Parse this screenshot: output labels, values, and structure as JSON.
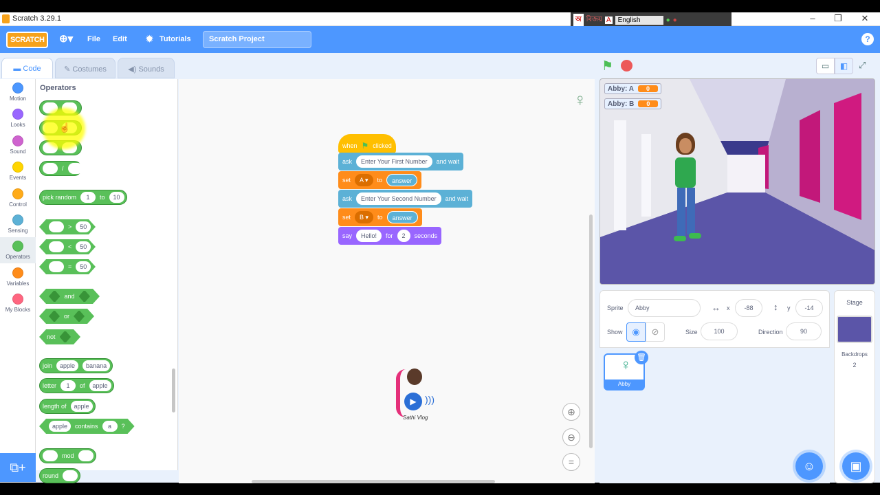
{
  "window": {
    "title": "Scratch 3.29.1"
  },
  "langbar": {
    "lang_text": "English"
  },
  "menu": {
    "logo": "SCRATCH",
    "file": "File",
    "edit": "Edit",
    "tutorials": "Tutorials",
    "project_title": "Scratch Project",
    "help": "?"
  },
  "tabs": {
    "code": "Code",
    "costumes": "Costumes",
    "sounds": "Sounds"
  },
  "categories": [
    {
      "label": "Motion",
      "color": "#4c97ff"
    },
    {
      "label": "Looks",
      "color": "#9966ff"
    },
    {
      "label": "Sound",
      "color": "#cf63cf"
    },
    {
      "label": "Events",
      "color": "#ffd500"
    },
    {
      "label": "Control",
      "color": "#ffab19"
    },
    {
      "label": "Sensing",
      "color": "#5cb1d6"
    },
    {
      "label": "Operators",
      "color": "#59c059"
    },
    {
      "label": "Variables",
      "color": "#ff8c1a"
    },
    {
      "label": "My Blocks",
      "color": "#ff6680"
    }
  ],
  "palette": {
    "heading": "Operators",
    "div_sign": "/",
    "pick_random": {
      "label": "pick random",
      "from": "1",
      "to_label": "to",
      "to": "10"
    },
    "gt": {
      "op": ">",
      "val": "50"
    },
    "lt": {
      "op": "<",
      "val": "50"
    },
    "eq": {
      "op": "=",
      "val": "50"
    },
    "and": "and",
    "or": "or",
    "not": "not",
    "join": {
      "label": "join",
      "a": "apple",
      "b": "banana"
    },
    "letter": {
      "label": "letter",
      "n": "1",
      "of": "of",
      "s": "apple"
    },
    "length": {
      "label": "length of",
      "s": "apple"
    },
    "contains": {
      "a": "apple",
      "label": "contains",
      "b": "a",
      "q": "?"
    },
    "mod": "mod",
    "round": "round"
  },
  "script": {
    "hat": {
      "when": "when",
      "clicked": "clicked"
    },
    "ask1": {
      "label": "ask",
      "text": "Enter Your First Number",
      "tail": "and wait"
    },
    "set1": {
      "label": "set",
      "var": "A ▾",
      "to": "to",
      "val": "answer"
    },
    "ask2": {
      "label": "ask",
      "text": "Enter Your Second Number",
      "tail": "and wait"
    },
    "set2": {
      "label": "set",
      "var": "B ▾",
      "to": "to",
      "val": "answer"
    },
    "say": {
      "label": "say",
      "text": "Hello!",
      "for": "for",
      "secs": "2",
      "unit": "seconds"
    }
  },
  "watermark": {
    "text": "Sathi Vlog"
  },
  "monitors": [
    {
      "label": "Abby: A",
      "value": "0"
    },
    {
      "label": "Abby: B",
      "value": "0"
    }
  ],
  "sprite_info": {
    "sprite_label": "Sprite",
    "sprite_name": "Abby",
    "x_label": "x",
    "x": "-88",
    "y_label": "y",
    "y": "-14",
    "show_label": "Show",
    "size_label": "Size",
    "size": "100",
    "direction_label": "Direction",
    "direction": "90"
  },
  "sprites": [
    {
      "name": "Abby"
    }
  ],
  "stage_panel": {
    "label": "Stage",
    "backdrops_label": "Backdrops",
    "backdrops_count": "2"
  }
}
